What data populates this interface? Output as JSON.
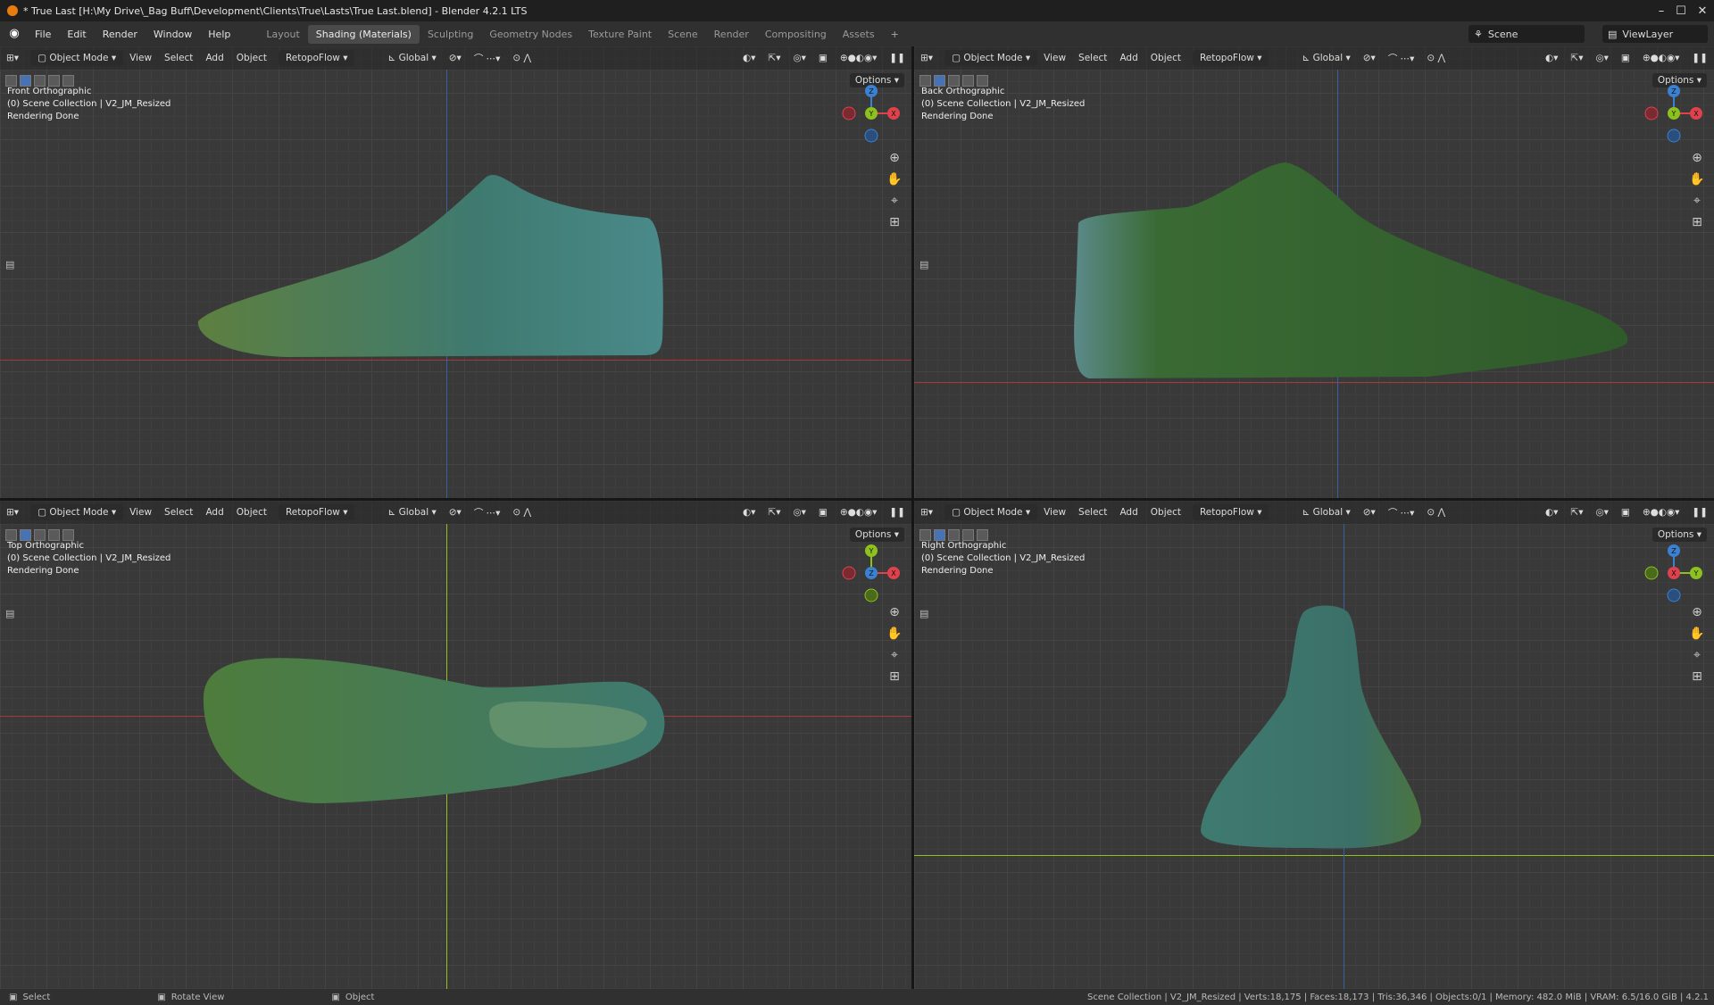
{
  "window": {
    "title": "* True Last [H:\\My Drive\\_Bag Buff\\Development\\Clients\\True\\Lasts\\True Last.blend] - Blender 4.2.1 LTS",
    "min": "–",
    "max": "☐",
    "close": "✕"
  },
  "menu": {
    "file": "File",
    "edit": "Edit",
    "render": "Render",
    "window": "Window",
    "help": "Help"
  },
  "workspaces": [
    "Layout",
    "Shading (Materials)",
    "Sculpting",
    "Geometry Nodes",
    "Texture Paint",
    "Scene",
    "Render",
    "Compositing",
    "Assets",
    "+"
  ],
  "active_workspace": "Shading (Materials)",
  "scene": {
    "label": "Scene",
    "viewlayer": "ViewLayer"
  },
  "vp_header": {
    "mode": "Object Mode",
    "view": "View",
    "select": "Select",
    "add": "Add",
    "object": "Object",
    "addon": "RetopoFlow",
    "transform": "Global",
    "options": "Options"
  },
  "viewports": [
    {
      "name": "Front Orthographic",
      "collection": "(0) Scene Collection | V2_JM_Resized",
      "status": "Rendering Done"
    },
    {
      "name": "Back Orthographic",
      "collection": "(0) Scene Collection | V2_JM_Resized",
      "status": "Rendering Done"
    },
    {
      "name": "Top Orthographic",
      "collection": "(0) Scene Collection | V2_JM_Resized",
      "status": "Rendering Done"
    },
    {
      "name": "Right Orthographic",
      "collection": "(0) Scene Collection | V2_JM_Resized",
      "status": "Rendering Done"
    }
  ],
  "gizmo_labels": {
    "x": "X",
    "y": "Y",
    "z": "Z"
  },
  "colors": {
    "x_axis": "#e0424d",
    "y_axis": "#8cc11f",
    "z_axis": "#3b81d1",
    "mesh_green": "#4b7a3c",
    "mesh_teal": "#3e7a74"
  },
  "status": {
    "select": "Select",
    "rotate": "Rotate View",
    "object": "Object",
    "stats": "Scene Collection | V2_JM_Resized | Verts:18,175 | Faces:18,173 | Tris:36,346 | Objects:0/1 | Memory: 482.0 MiB | VRAM: 6.5/16.0 GiB | 4.2.1"
  }
}
